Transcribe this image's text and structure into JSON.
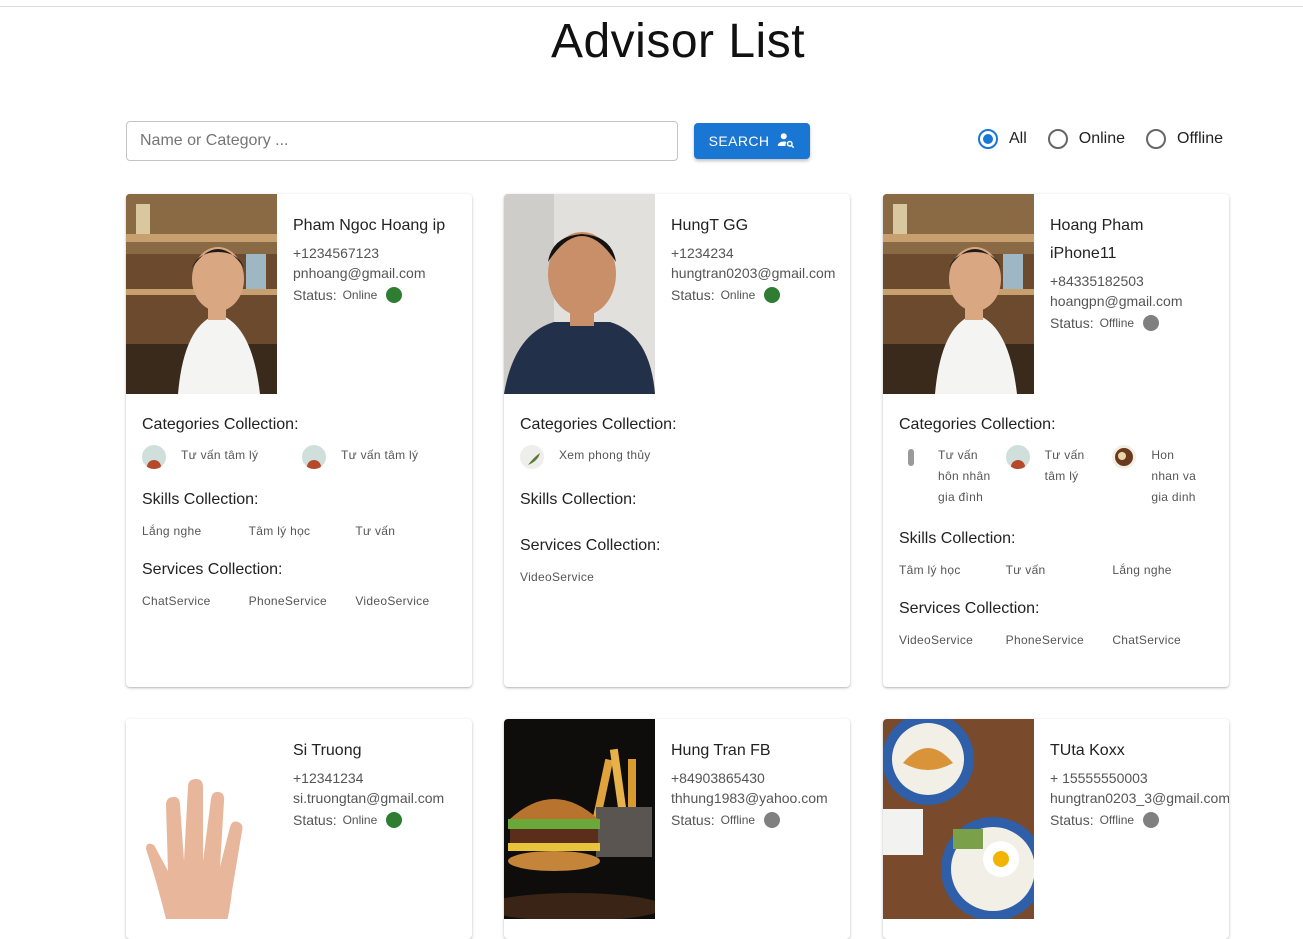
{
  "page": {
    "title": "Advisor List"
  },
  "search": {
    "placeholder": "Name or Category ...",
    "value": "",
    "button_label": "SEARCH"
  },
  "filter": {
    "options": [
      {
        "label": "All",
        "checked": true
      },
      {
        "label": "Online",
        "checked": false
      },
      {
        "label": "Offline",
        "checked": false
      }
    ]
  },
  "labels": {
    "status": "Status:",
    "categories": "Categories Collection:",
    "skills": "Skills Collection:",
    "services": "Services Collection:"
  },
  "advisors": [
    {
      "name": "Pham Ngoc Hoang ip",
      "phone": "+1234567123",
      "email": "pnhoang@gmail.com",
      "status": "Online",
      "categories": [
        "Tư vấn tâm lý",
        "Tư vấn tâm lý"
      ],
      "skills": [
        "Lắng nghe",
        "Tâm lý học",
        "Tư vấn"
      ],
      "services": [
        "ChatService",
        "PhoneService",
        "VideoService"
      ]
    },
    {
      "name": "HungT GG",
      "phone": "+1234234",
      "email": "hungtran0203@gmail.com",
      "status": "Online",
      "categories": [
        "Xem phong thủy"
      ],
      "skills": [],
      "services": [
        "VideoService"
      ]
    },
    {
      "name": "Hoang Pham iPhone11",
      "phone": "+84335182503",
      "email": "hoangpn@gmail.com",
      "status": "Offline",
      "categories": [
        "Tư vấn hôn nhân gia đình",
        "Tư vấn tâm lý",
        "Hon nhan va gia dinh"
      ],
      "skills": [
        "Tâm lý học",
        "Tư vấn",
        "Lắng nghe"
      ],
      "services": [
        "VideoService",
        "PhoneService",
        "ChatService"
      ]
    },
    {
      "name": "Si Truong",
      "phone": "+12341234",
      "email": "si.truongtan@gmail.com",
      "status": "Online"
    },
    {
      "name": "Hung Tran FB",
      "phone": "+84903865430",
      "email": "thhung1983@yahoo.com",
      "status": "Offline"
    },
    {
      "name": "TUta Koxx",
      "phone": "+ 15555550003",
      "email": "hungtran0203_3@gmail.com",
      "status": "Offline"
    }
  ],
  "colors": {
    "primary": "#1976d2",
    "online": "#2e7d32",
    "offline": "#808080"
  }
}
